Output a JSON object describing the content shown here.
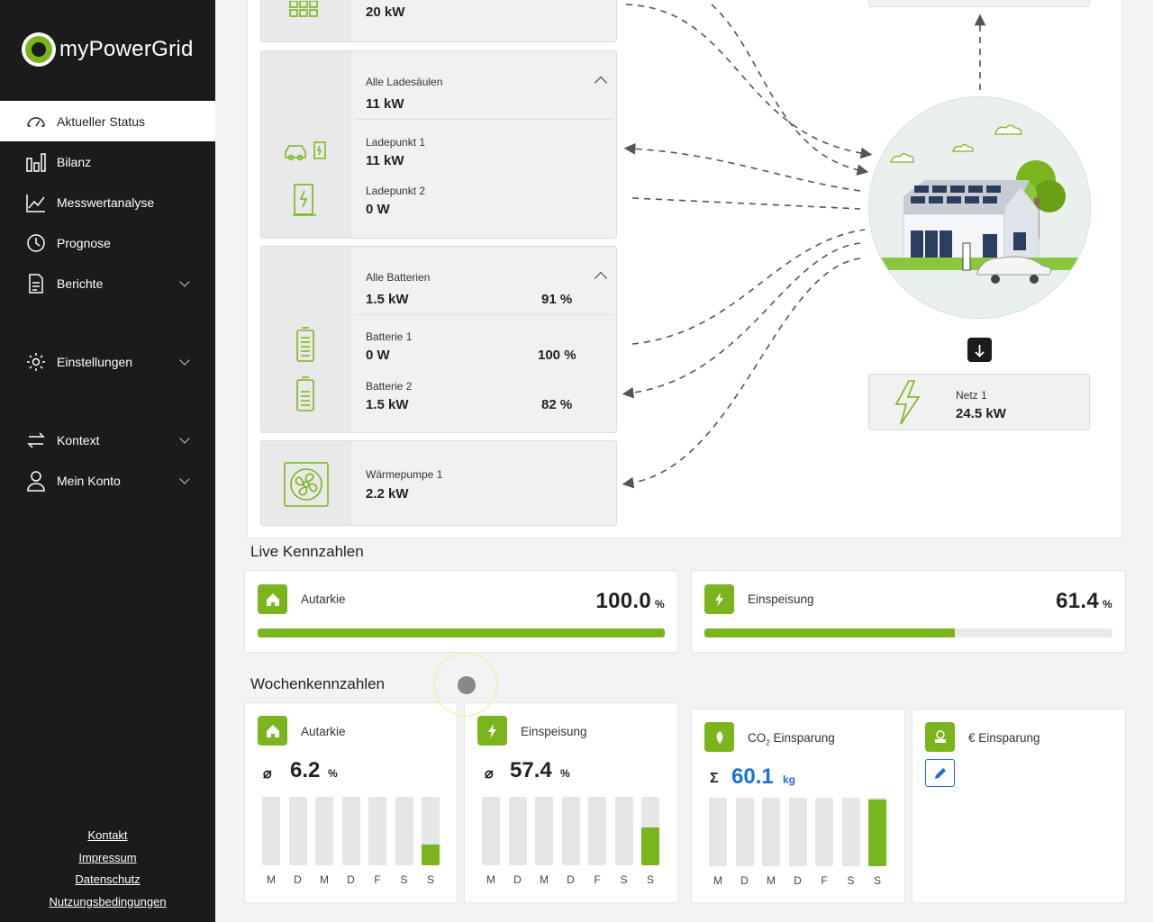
{
  "app": {
    "name": "myPowerGrid"
  },
  "nav": [
    {
      "label": "Aktueller Status",
      "icon": "gauge-icon",
      "active": true
    },
    {
      "label": "Bilanz",
      "icon": "bar-chart-icon"
    },
    {
      "label": "Messwertanalyse",
      "icon": "line-chart-icon"
    },
    {
      "label": "Prognose",
      "icon": "clock-icon"
    },
    {
      "label": "Berichte",
      "icon": "document-icon",
      "expandable": true
    },
    {
      "label": "Einstellungen",
      "icon": "gear-icon",
      "expandable": true
    },
    {
      "label": "Kontext",
      "icon": "swap-arrows-icon",
      "expandable": true
    },
    {
      "label": "Mein Konto",
      "icon": "user-icon",
      "expandable": true
    }
  ],
  "footer": [
    "Kontakt",
    "Impressum",
    "Datenschutz",
    "Nutzungsbedingungen"
  ],
  "pv": {
    "value": "20 kW"
  },
  "chargers": {
    "title": "Alle Ladesäulen",
    "total": "11 kW",
    "items": [
      {
        "name": "Ladepunkt 1",
        "value": "11 kW"
      },
      {
        "name": "Ladepunkt 2",
        "value": "0 W"
      }
    ]
  },
  "batteries": {
    "title": "Alle Batterien",
    "total": "1.5 kW",
    "total_pct": "91 %",
    "items": [
      {
        "name": "Batterie 1",
        "value": "0 W",
        "pct": "100 %"
      },
      {
        "name": "Batterie 2",
        "value": "1.5 kW",
        "pct": "82 %"
      }
    ]
  },
  "heatpump": {
    "name": "Wärmepumpe 1",
    "value": "2.2 kW"
  },
  "grid": {
    "name": "Netz 1",
    "value": "24.5 kW"
  },
  "live": {
    "title": "Live Kennzahlen",
    "autarkie": {
      "label": "Autarkie",
      "value": "100.0",
      "unit": "%",
      "fraction": 1.0
    },
    "einspeisung": {
      "label": "Einspeisung",
      "value": "61.4",
      "unit": "%",
      "fraction": 0.614
    }
  },
  "weekly": {
    "title": "Wochenkennzahlen",
    "days": [
      "M",
      "D",
      "M",
      "D",
      "F",
      "S",
      "S"
    ],
    "autarkie": {
      "label": "Autarkie",
      "prefix": "⌀",
      "value": "6.2",
      "unit": "%",
      "levels": [
        0,
        0,
        0,
        0,
        0,
        0,
        0.3
      ]
    },
    "einspeisung": {
      "label": "Einspeisung",
      "prefix": "⌀",
      "value": "57.4",
      "unit": "%",
      "levels": [
        0,
        0,
        0,
        0,
        0,
        0,
        0.55
      ]
    },
    "co2": {
      "label_pre": "CO",
      "label_sub": "2",
      "label_post": " Einsparung",
      "prefix": "Σ",
      "value": "60.1",
      "unit": "kg",
      "levels": [
        0,
        0,
        0,
        0,
        0,
        0,
        0.97
      ]
    },
    "euro": {
      "label": "€ Einsparung"
    }
  },
  "colors": {
    "accent": "#7ab51d",
    "sidebar": "#1b1b1b",
    "link_blue": "#1e6fd9"
  }
}
